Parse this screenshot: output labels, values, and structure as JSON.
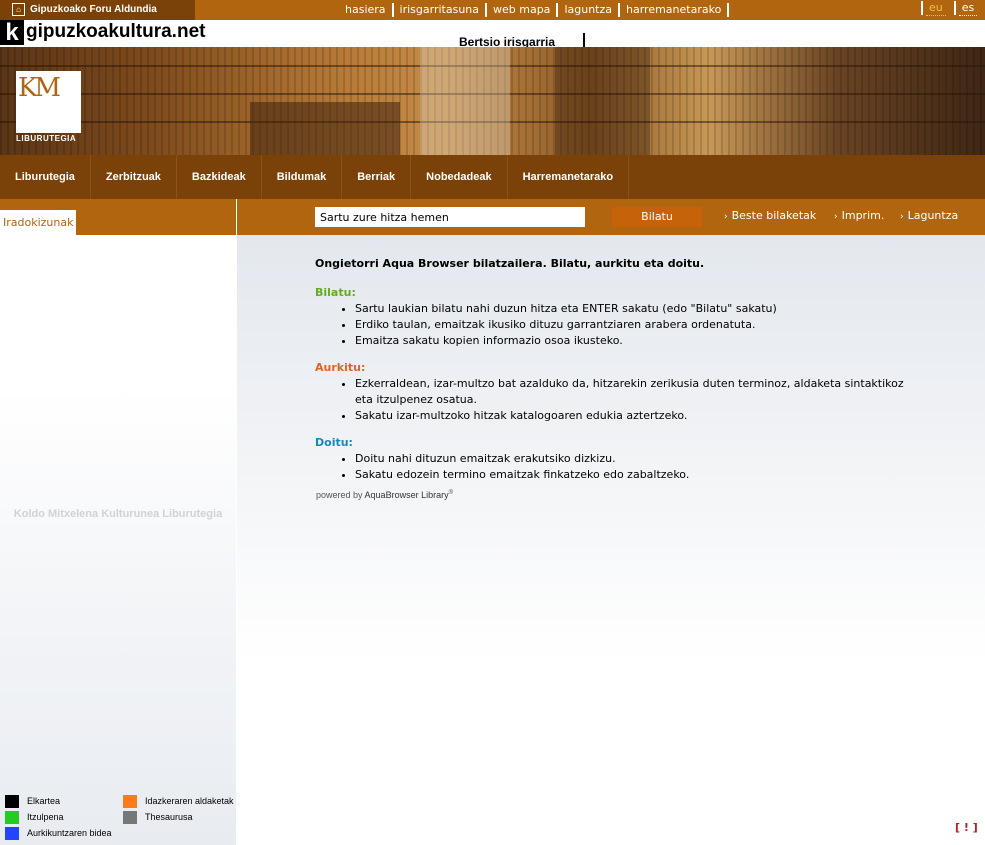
{
  "topbar": {
    "org_name": "Gipuzkoako Foru Aldundia",
    "links": [
      "hasiera",
      "irisgarritasuna",
      "web mapa",
      "laguntza",
      "harremanetarako"
    ],
    "languages": [
      {
        "code": "eu",
        "color": "#f0c040"
      },
      {
        "code": "es",
        "color": "#ffffff"
      }
    ]
  },
  "header": {
    "badge_letter": "k",
    "site_title": "gipuzkoakultura.net",
    "motto": "Bertsio irisgarria"
  },
  "banner": {
    "logo_initials": "KM",
    "logo_caption": "LIBURUTEGIA"
  },
  "main_nav": [
    "Liburutegia",
    "Zerbitzuak",
    "Bazkideak",
    "Bildumak",
    "Berriak",
    "Nobedadeak",
    "Harremanetarako"
  ],
  "search": {
    "doc_tab": "Iradokizunak",
    "input_value": "Sartu zure hitza hemen",
    "button_label": "Bilatu",
    "tools": [
      "Beste bilaketak",
      "Imprim.",
      "Laguntza"
    ]
  },
  "left_panel": {
    "library_name": "Koldo Mitxelena Kulturunea Liburutegia",
    "legend": [
      {
        "label": "Elkartea",
        "color": "#000000"
      },
      {
        "label": "Idazkeraren aldaketak",
        "color": "#ff7a1a"
      },
      {
        "label": "Itzulpena",
        "color": "#22cc22"
      },
      {
        "label": "Thesaurusa",
        "color": "#777777"
      },
      {
        "label": "Aurkikuntzaren bidea",
        "color": "#2244ff"
      }
    ]
  },
  "welcome": {
    "title": "Ongietorri Aqua Browser bilatzailera. Bilatu, aurkitu eta doitu.",
    "sections": [
      {
        "heading": "Bilatu:",
        "color": "#66aa22",
        "items": [
          "Sartu laukian bilatu nahi duzun hitza eta ENTER sakatu (edo \"Bilatu\" sakatu)",
          "Erdiko taulan, emaitzak ikusiko dituzu garrantziaren arabera ordenatuta.",
          "Emaitza sakatu kopien informazio osoa ikusteko."
        ]
      },
      {
        "heading": "Aurkitu:",
        "color": "#e0661e",
        "items": [
          "Ezkerraldean, izar-multzo bat azalduko da, hitzarekin zerikusia duten terminoz, aldaketa sintaktikoz eta itzulpenez osatua.",
          "Sakatu izar-multzoko hitzak katalogoaren edukia aztertzeko."
        ]
      },
      {
        "heading": "Doitu:",
        "color": "#1a86c0",
        "items": [
          "Doitu nahi dituzun emaitzak erakutsiko dizkizu.",
          "Sakatu edozein termino emaitzak finkatzeko edo zabaltzeko."
        ]
      }
    ],
    "powered_prefix": "powered by",
    "powered_brand": "AquaBrowser Library"
  },
  "feedback_label": "[ ! ]"
}
